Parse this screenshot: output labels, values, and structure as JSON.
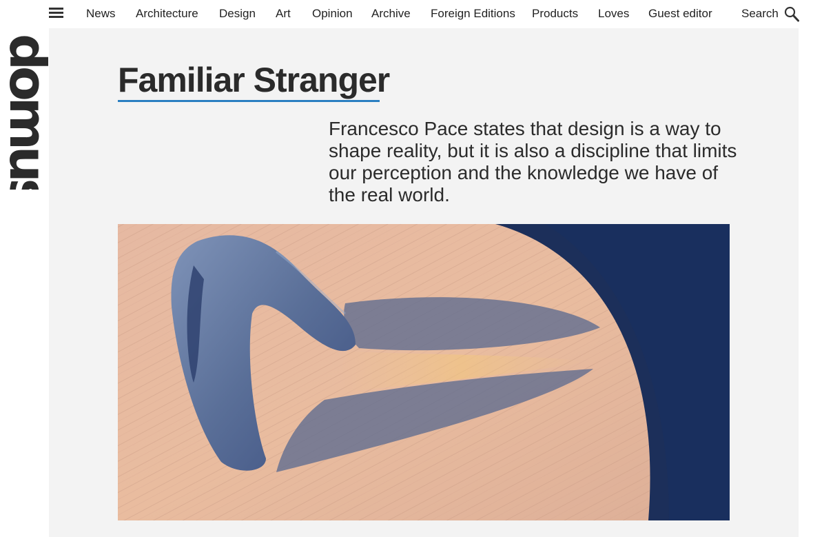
{
  "nav": {
    "menu_icon": "hamburger-menu-icon",
    "items": [
      "News",
      "Architecture",
      "Design",
      "Art",
      "Opinion",
      "Archive",
      "Foreign Editions",
      "Products",
      "Loves",
      "Guest editor"
    ],
    "search_label": "Search",
    "search_icon": "magnifier-icon"
  },
  "brand": {
    "logo_text": "domus"
  },
  "article": {
    "title": "Familiar Stranger",
    "standfirst": "Francesco Pace states that design is a way to shape reality, but it is also a discipline that limits our perception and the knowledge we have of the real world."
  },
  "colors": {
    "accent_underline": "#2a7fc1",
    "panel_background": "#f3f3f3",
    "text": "#2b2b2b"
  }
}
